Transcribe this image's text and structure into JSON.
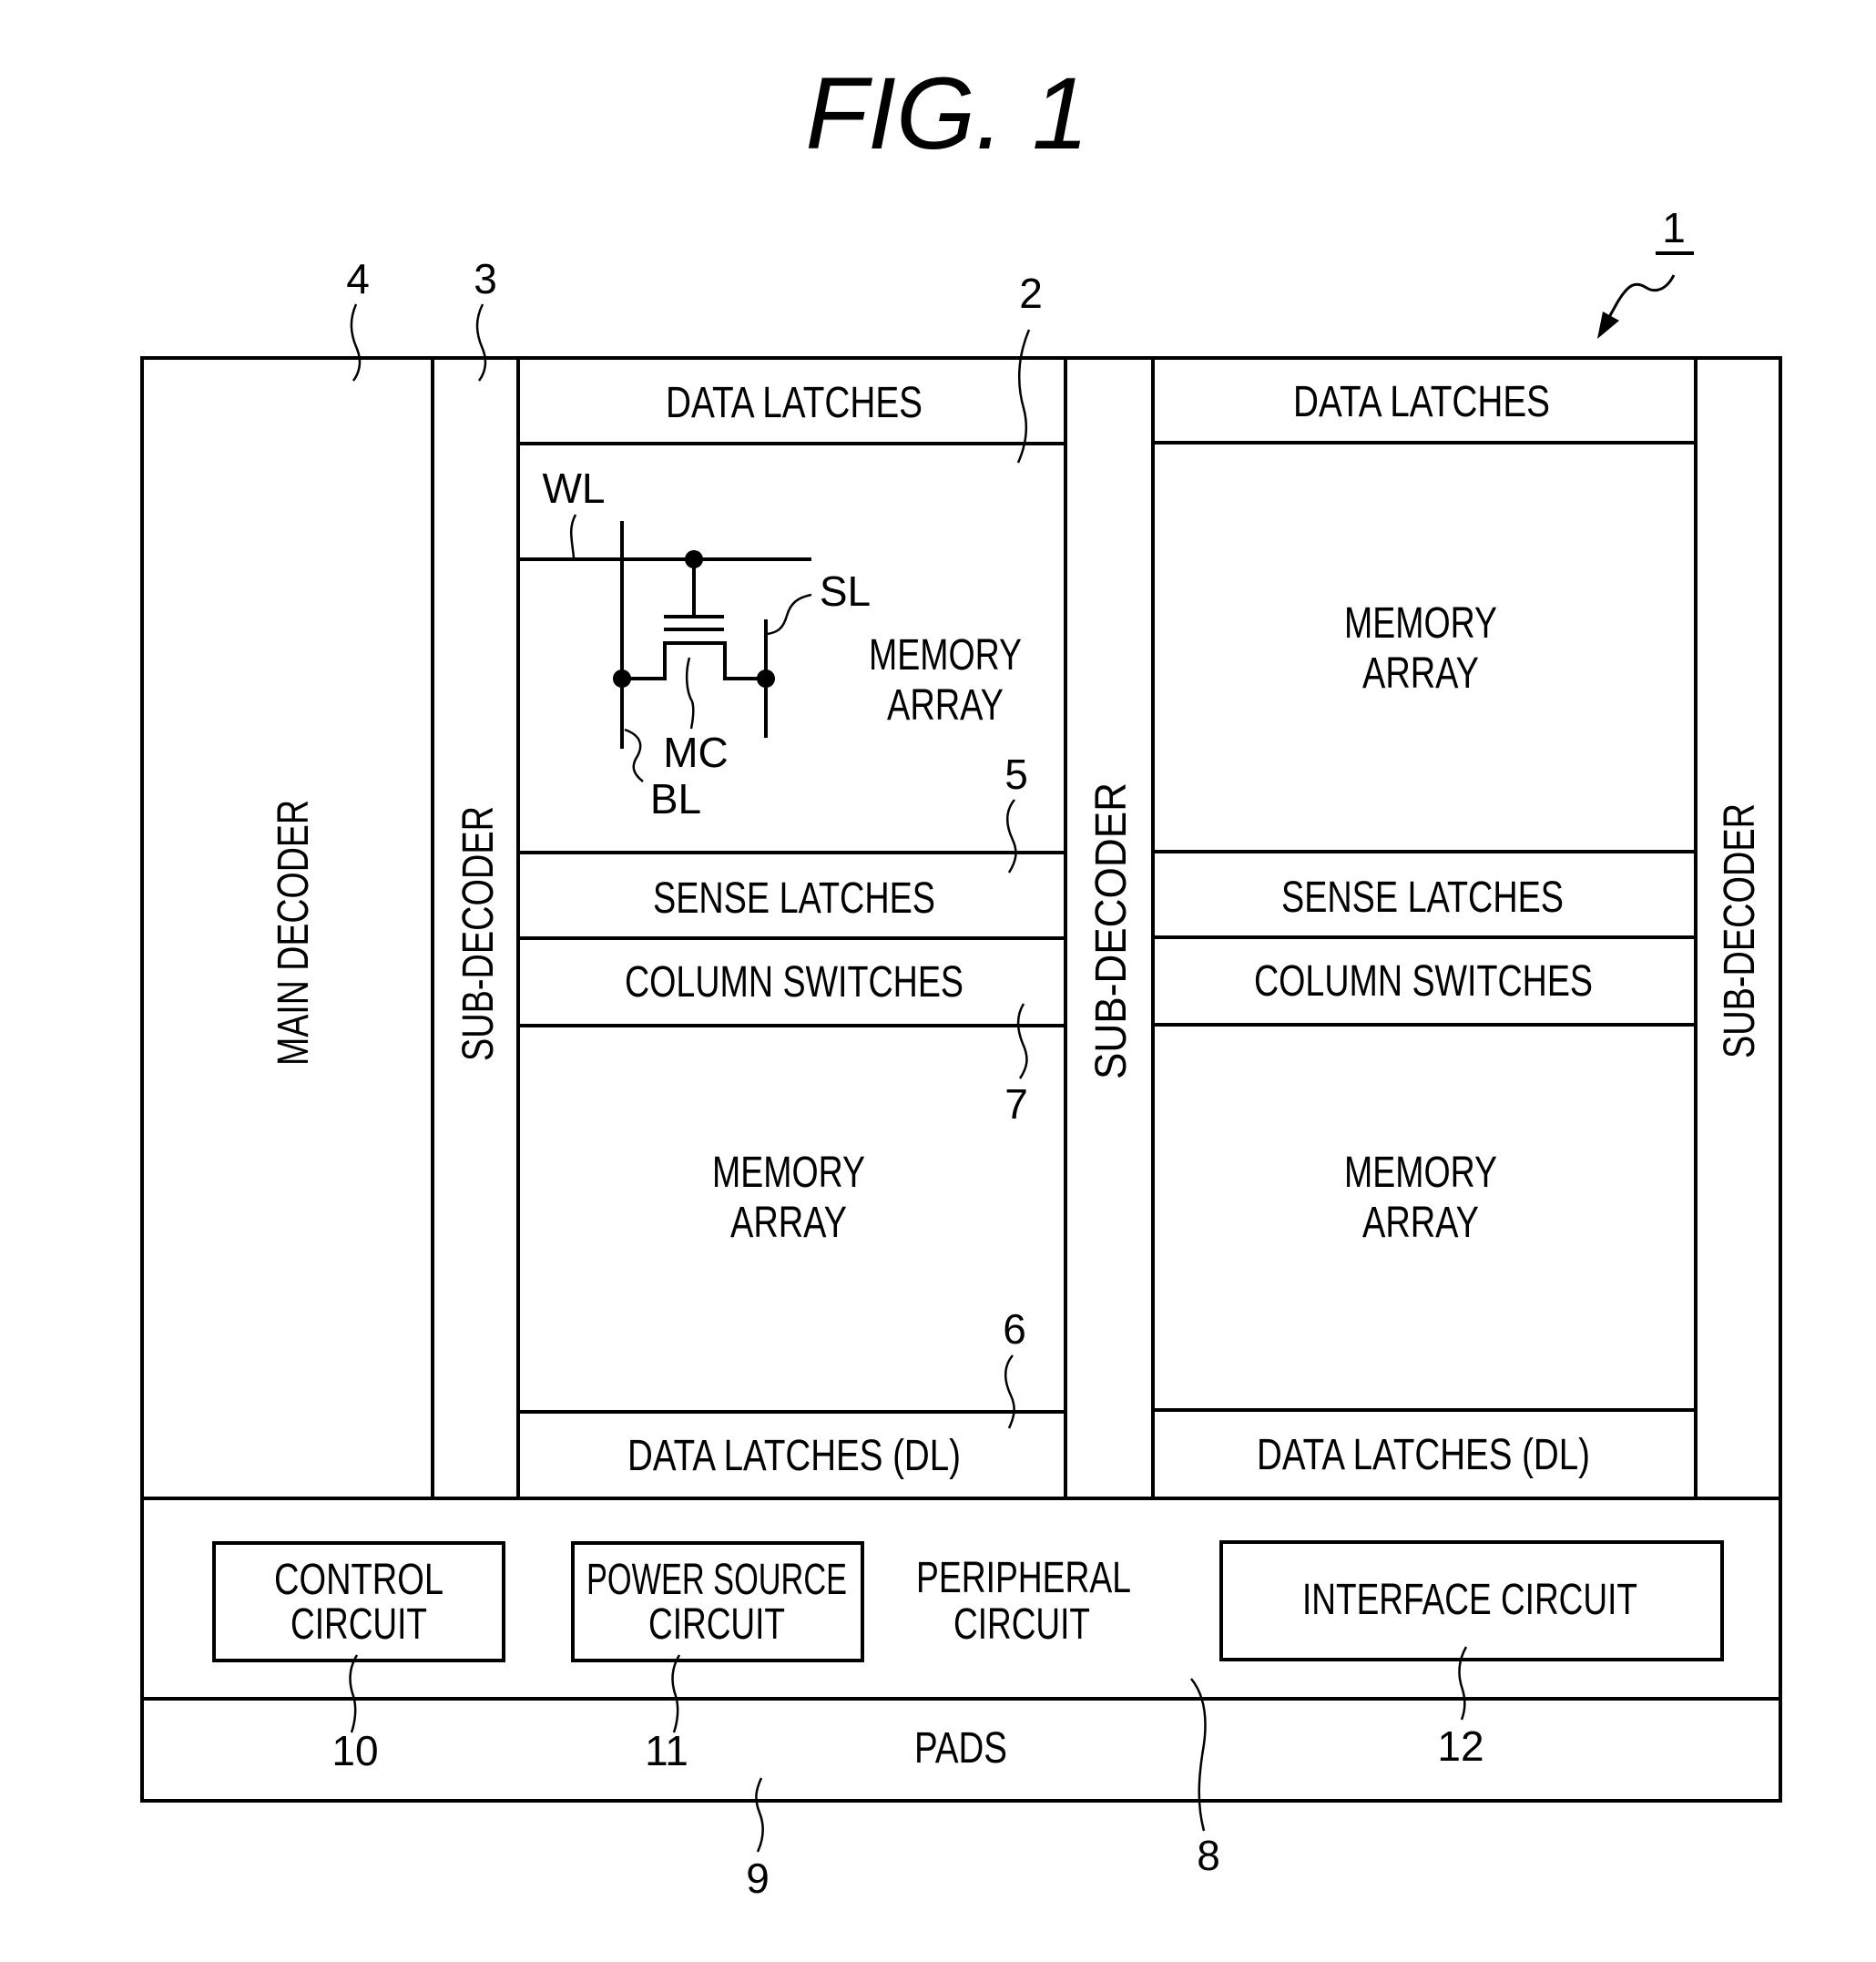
{
  "figure": {
    "title": "FIG. 1",
    "device_ref": "1"
  },
  "left_column": {
    "main_decoder": "MAIN DECODER",
    "main_decoder_ref": "4",
    "sub_decoder": "SUB-DECODER",
    "sub_decoder_ref": "3"
  },
  "left_panel": {
    "data_latches_top": "DATA LATCHES",
    "memory_array_top": [
      "MEMORY",
      "ARRAY"
    ],
    "sense_latches": "SENSE LATCHES",
    "column_switches": "COLUMN SWITCHES",
    "memory_array_bottom": [
      "MEMORY",
      "ARRAY"
    ],
    "data_latches_bottom": "DATA LATCHES (DL)",
    "refs": {
      "memory_array": "2",
      "sense_latches": "5",
      "column_switches": "7",
      "data_latches_dl": "6"
    },
    "cell": {
      "word_line": "WL",
      "source_line": "SL",
      "memory_cell": "MC",
      "bit_line": "BL"
    }
  },
  "middle_sub_decoder": "SUB-DECODER",
  "right_panel": {
    "data_latches_top": "DATA LATCHES",
    "memory_array_top": [
      "MEMORY",
      "ARRAY"
    ],
    "sense_latches": "SENSE LATCHES",
    "column_switches": "COLUMN SWITCHES",
    "memory_array_bottom": [
      "MEMORY",
      "ARRAY"
    ],
    "data_latches_bottom": "DATA LATCHES (DL)"
  },
  "right_sub_decoder": "SUB-DECODER",
  "peripheral": {
    "label": [
      "PERIPHERAL",
      "CIRCUIT"
    ],
    "ref": "8",
    "control_circuit": [
      "CONTROL",
      "CIRCUIT"
    ],
    "control_ref": "10",
    "power_source_circuit": [
      "POWER SOURCE",
      "CIRCUIT"
    ],
    "power_ref": "11",
    "interface_circuit": "INTERFACE CIRCUIT",
    "interface_ref": "12"
  },
  "pads": {
    "label": "PADS",
    "ref": "9"
  }
}
